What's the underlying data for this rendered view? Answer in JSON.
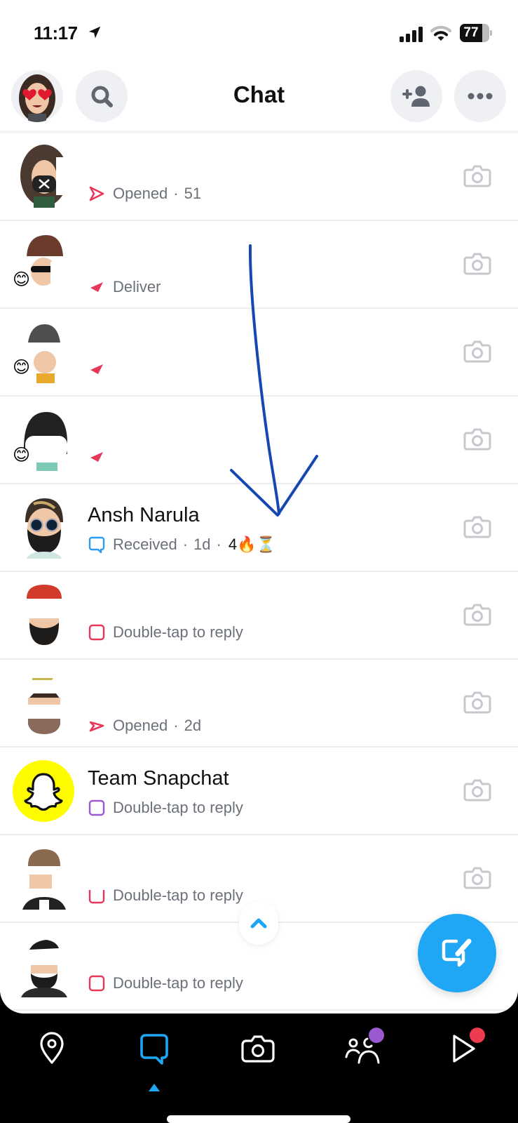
{
  "status_bar": {
    "time": "11:17",
    "battery_percent": 77,
    "battery_label": "77"
  },
  "header": {
    "title": "Chat",
    "avatar_icon": "bitmoji-heart-eyes-avatar",
    "search_icon": "search-icon",
    "add_friend_icon": "add-friend-icon",
    "more_icon": "more-dots-icon"
  },
  "chats": [
    {
      "name": "",
      "status_icon": "sent-opened-arrow",
      "status_color": "#e8385a",
      "status": "Opened",
      "time": "51",
      "streak": "",
      "redacted": true,
      "emoji_badge": ""
    },
    {
      "name": "",
      "status_icon": "sent-arrow-filled",
      "status_color": "#e8385a",
      "status": "Deliver",
      "time": "",
      "streak": "",
      "redacted": true,
      "emoji_badge": "😊"
    },
    {
      "name": "",
      "status_icon": "sent-arrow-filled",
      "status_color": "#e8385a",
      "status": "",
      "time": "",
      "streak": "",
      "redacted": true,
      "emoji_badge": "😊"
    },
    {
      "name": "",
      "status_icon": "sent-arrow-filled",
      "status_color": "#e8385a",
      "status": "",
      "time": "",
      "streak": "",
      "redacted": true,
      "emoji_badge": "😊"
    },
    {
      "name": "Ansh Narula",
      "status_icon": "chat-bubble-outline",
      "status_color": "#2a9df4",
      "status": "Received",
      "time": "1d",
      "streak": "4🔥⏳",
      "redacted": false,
      "emoji_badge": ""
    },
    {
      "name": "",
      "status_icon": "snap-square-outline",
      "status_color": "#e8385a",
      "status": "Double-tap to reply",
      "time": "",
      "streak": "",
      "redacted": true,
      "emoji_badge": ""
    },
    {
      "name": "",
      "status_icon": "sent-opened-arrow",
      "status_color": "#e8385a",
      "status": "Opened",
      "time": "2d",
      "streak": "",
      "redacted": true,
      "emoji_badge": ""
    },
    {
      "name": "Team Snapchat",
      "status_icon": "snap-square-outline",
      "status_color": "#9b59d0",
      "status": "Double-tap to reply",
      "time": "",
      "streak": "",
      "redacted": false,
      "emoji_badge": ""
    },
    {
      "name": "",
      "status_icon": "snap-square-outline",
      "status_color": "#e8385a",
      "status": "Double-tap to reply",
      "time": "",
      "streak": "",
      "redacted": true,
      "emoji_badge": ""
    },
    {
      "name": "",
      "status_icon": "snap-square-outline",
      "status_color": "#e8385a",
      "status": "Double-tap to reply",
      "time": "",
      "streak": "",
      "redacted": true,
      "emoji_badge": ""
    }
  ],
  "separator": "·",
  "fab": {
    "icon": "compose-chat-icon",
    "color": "#1fa7f5"
  },
  "scroll_up": {
    "icon": "chevron-up-icon"
  },
  "bottom_nav": {
    "items": [
      {
        "id": "map",
        "icon": "map-pin-icon",
        "active": false,
        "badge_color": ""
      },
      {
        "id": "chat",
        "icon": "chat-bubble-icon",
        "active": true,
        "badge_color": ""
      },
      {
        "id": "camera",
        "icon": "camera-icon",
        "active": false,
        "badge_color": ""
      },
      {
        "id": "stories",
        "icon": "friends-icon",
        "active": false,
        "badge_color": "#9b59d0"
      },
      {
        "id": "spotlight",
        "icon": "play-icon",
        "active": false,
        "badge_color": "#ee3b4f"
      }
    ],
    "active_color": "#1fa7f5"
  },
  "colors": {
    "accent": "#1fa7f5",
    "sent_red": "#e8385a",
    "received_blue": "#2a9df4",
    "snapchat_yellow": "#fffc00",
    "annotation_blue": "#1747b3"
  }
}
